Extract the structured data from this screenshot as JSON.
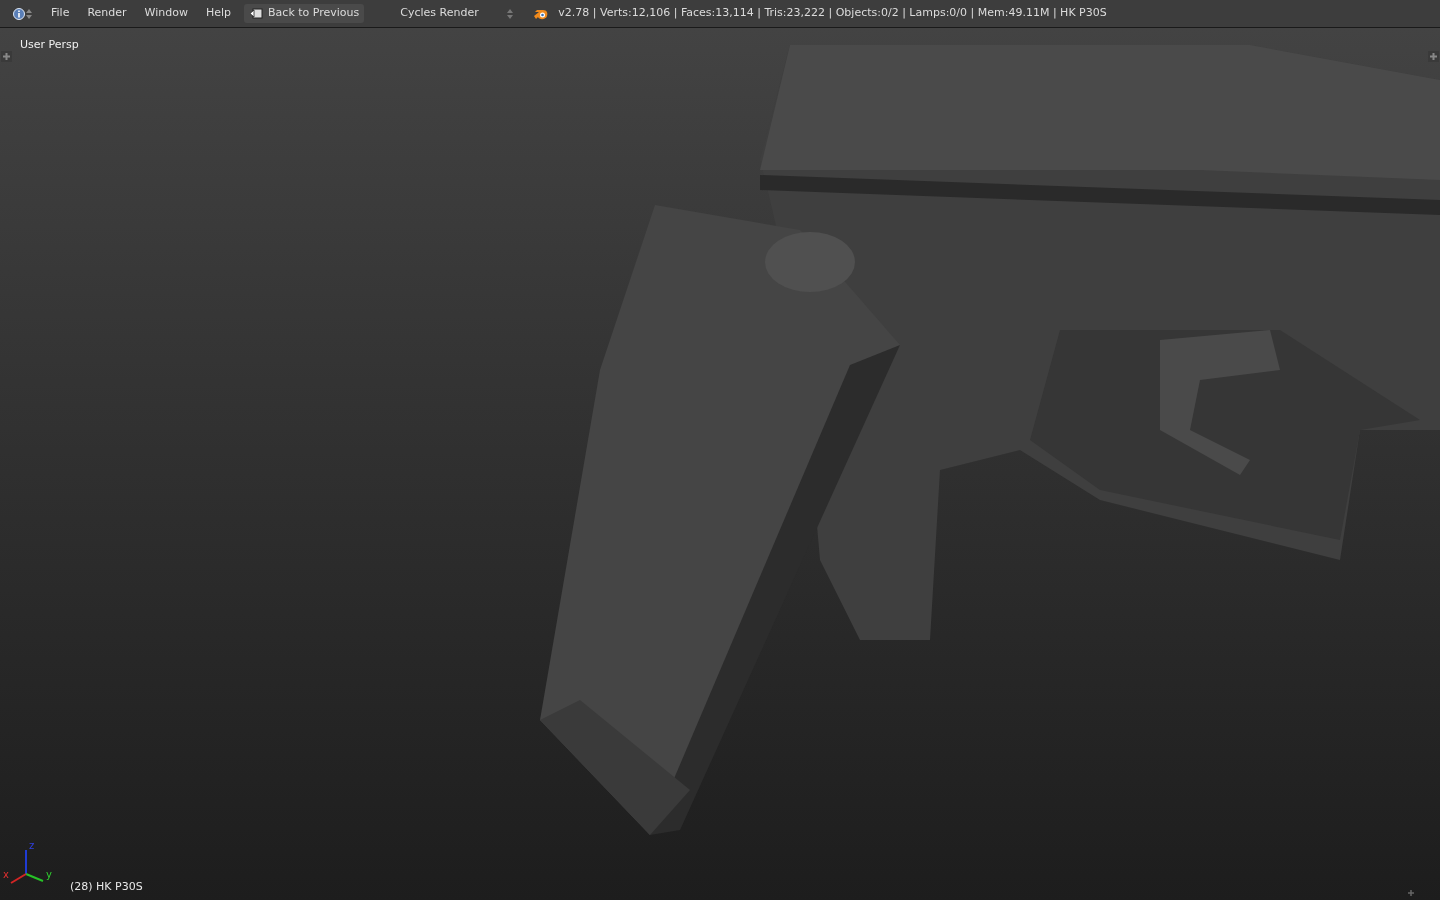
{
  "header": {
    "menus": [
      "File",
      "Render",
      "Window",
      "Help"
    ],
    "back_button": "Back to Previous",
    "engine": "Cycles Render",
    "stats": "v2.78 | Verts:12,106 | Faces:13,114 | Tris:23,222 | Objects:0/2 | Lamps:0/0 | Mem:49.11M | HK P30S"
  },
  "viewport": {
    "view_name": "User Persp",
    "object_label": "(28) HK P30S",
    "axes": [
      "x",
      "y",
      "z"
    ]
  }
}
